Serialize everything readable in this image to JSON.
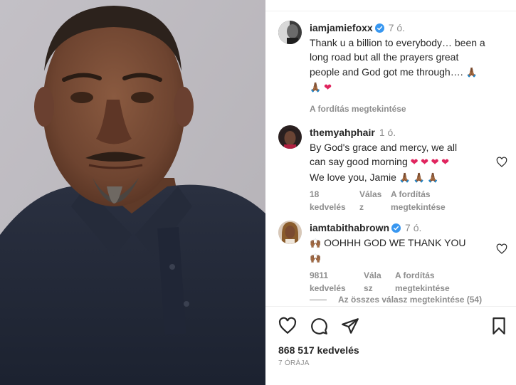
{
  "post": {
    "author": "iamjamiefoxx",
    "time": "7 ó.",
    "caption_lines": [
      "Thank u a billion to everybody… been a",
      "long road but all the prayers great",
      "people and God got me through…."
    ],
    "see_translation": "A fordítás megtekintése"
  },
  "comments": [
    {
      "username": "themyahphair",
      "time": "1 ó.",
      "lines": [
        "By God's grace and mercy, we all",
        "can say good morning",
        "We love you, Jamie"
      ],
      "likes_line1": "18",
      "likes_line2": "kedvelés",
      "reply_line1": "Válas",
      "reply_line2": "z",
      "translate_line1": "A fordítás",
      "translate_line2": "megtekintése"
    },
    {
      "username": "iamtabithabrown",
      "time": "7 ó.",
      "lines": [
        "OOHHH GOD WE THANK YOU"
      ],
      "likes_line1": "9811",
      "likes_line2": "kedvelés",
      "reply_line1": "Vála",
      "reply_line2": "sz",
      "translate_line1": "A fordítás",
      "translate_line2": "megtekintése"
    }
  ],
  "view_all_replies": "Az összes válasz megtekintése (54)",
  "footer": {
    "likes": "868 517 kedvelés",
    "date": "7 ÓRÁJA"
  },
  "icons": {
    "like": "heart-outline-icon",
    "comment": "speech-bubble-icon",
    "share": "paper-plane-icon",
    "save": "bookmark-icon",
    "verified": "verified-badge-icon"
  },
  "colors": {
    "verified": "#3897f0",
    "muted_text": "#8e8e8e",
    "heart_emoji": "#e0245e"
  }
}
